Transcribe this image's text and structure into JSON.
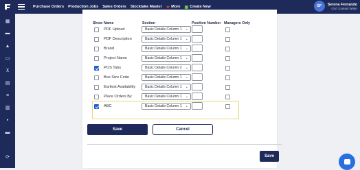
{
  "topbar": {
    "nav": [
      {
        "label": "Purchase Orders",
        "icon": ""
      },
      {
        "label": "Production Jobs",
        "icon": ""
      },
      {
        "label": "Sales Orders",
        "icon": ""
      },
      {
        "label": "Stocktake Master",
        "icon": ""
      },
      {
        "label": "More",
        "icon": "star-icon"
      },
      {
        "label": "Create New",
        "icon": "plus-square-icon"
      }
    ],
    "user": {
      "initials": "SF",
      "name": "Serena Fernando",
      "role": "Cin7 Content Writer"
    }
  },
  "sidebar": {
    "icons": [
      "logo-icon",
      "dashboard-icon",
      "inbox-icon",
      "cart-icon",
      "folder-icon",
      "document-icon",
      "shopping-cart-icon",
      "stack-icon",
      "users-icon",
      "chart-icon",
      "layers-icon",
      "calendar-icon",
      "settings-icon"
    ]
  },
  "table": {
    "headers": {
      "show": "Show",
      "name": "Name",
      "section": "Section",
      "position": "Position Number",
      "managers": "Managers Only"
    },
    "rows": [
      {
        "checked": false,
        "name": "PDF Upload",
        "section": "Basic Details Column 1"
      },
      {
        "checked": false,
        "name": "PDF Description",
        "section": "Basic Details Column 1"
      },
      {
        "checked": false,
        "name": "Brand",
        "section": "Basic Details Column 1"
      },
      {
        "checked": false,
        "name": "Project Name",
        "section": "Basic Details Column 1"
      },
      {
        "checked": true,
        "name": "POS Tabs",
        "section": "Basic Details Column 2"
      },
      {
        "checked": false,
        "name": "Box Size Code",
        "section": "Basic Details Column 1"
      },
      {
        "checked": false,
        "name": "Earliest Availability",
        "section": "Basic Details Column 1"
      },
      {
        "checked": false,
        "name": "Place Orders By",
        "section": "Basic Details Column 1"
      },
      {
        "checked": true,
        "name": "ABC",
        "section": "Basic Details Column 1"
      }
    ]
  },
  "actions": {
    "save": "Save",
    "cancel": "Cancel",
    "save_bottom": "Save"
  },
  "colors": {
    "navy": "#1e2a5a",
    "accent": "#1f5fd6",
    "highlight_border": "#e4d67a"
  }
}
